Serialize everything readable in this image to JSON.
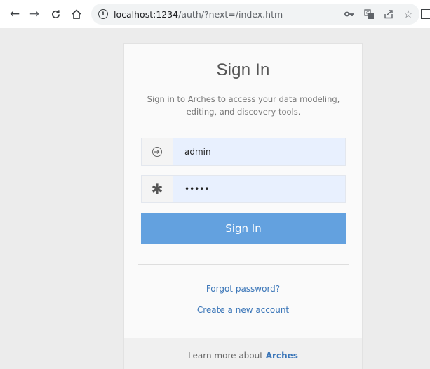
{
  "browser": {
    "url_host": "localhost:1234",
    "url_path": "/auth/?next=/index.htm",
    "icons": [
      "arrow-left",
      "arrow-right",
      "reload",
      "home",
      "info",
      "key",
      "translate",
      "share",
      "star",
      "side-panel"
    ]
  },
  "signin": {
    "title": "Sign In",
    "subtitle": "Sign in to Arches to access your data modeling, editing, and discovery tools.",
    "username_value": "admin",
    "password_value": "•••••",
    "button_label": "Sign In",
    "forgot_label": "Forgot password?",
    "create_label": "Create a new account"
  },
  "footer": {
    "text": "Learn more about",
    "brand": "Arches"
  },
  "colors": {
    "button": "#63a1df",
    "link": "#3b76b8",
    "autofill": "#e8f0fe"
  }
}
